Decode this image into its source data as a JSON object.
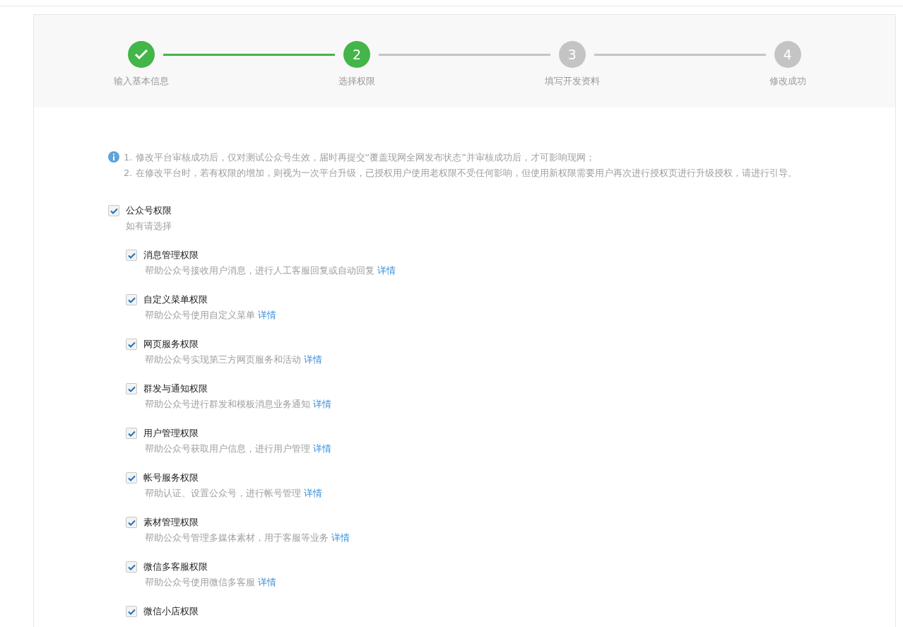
{
  "steps": [
    {
      "label": "输入基本信息",
      "completed": true,
      "active": true
    },
    {
      "number": "2",
      "label": "选择权限",
      "completed": false,
      "active": true
    },
    {
      "number": "3",
      "label": "填写开发资料",
      "completed": false,
      "active": false
    },
    {
      "number": "4",
      "label": "修改成功",
      "completed": false,
      "active": false
    }
  ],
  "notice": [
    "1. 修改平台审核成功后，仅对测试公众号生效，届时再提交“覆盖现网全网发布状态”并审核成功后，才可影响现网；",
    "2. 在修改平台时，若有权限的增加，则视为一次平台升级，已授权用户使用老权限不受任何影响，但使用新权限需要用户再次进行授权页进行升级授权，请进行引导。"
  ],
  "permission_group": {
    "label": "公众号权限",
    "checked": true,
    "hint": "如有请选择",
    "children": [
      {
        "label": "消息管理权限",
        "checked": true,
        "description": "帮助公众号接收用户消息，进行人工客服回复或自动回复",
        "link": "详情"
      },
      {
        "label": "自定义菜单权限",
        "checked": true,
        "description": "帮助公众号使用自定义菜单",
        "link": "详情"
      },
      {
        "label": "网页服务权限",
        "checked": true,
        "description": "帮助公众号实现第三方网页服务和活动",
        "link": "详情"
      },
      {
        "label": "群发与通知权限",
        "checked": true,
        "description": "帮助公众号进行群发和模板消息业务通知",
        "link": "详情"
      },
      {
        "label": "用户管理权限",
        "checked": true,
        "description": "帮助公众号获取用户信息，进行用户管理",
        "link": "详情"
      },
      {
        "label": "帐号服务权限",
        "checked": true,
        "description": "帮助认证、设置公众号，进行帐号管理",
        "link": "详情"
      },
      {
        "label": "素材管理权限",
        "checked": true,
        "description": "帮助公众号管理多媒体素材，用于客服等业务",
        "link": "详情"
      },
      {
        "label": "微信多客服权限",
        "checked": true,
        "description": "帮助公众号使用微信多客服",
        "link": "详情"
      },
      {
        "label": "微信小店权限",
        "checked": true
      }
    ]
  }
}
